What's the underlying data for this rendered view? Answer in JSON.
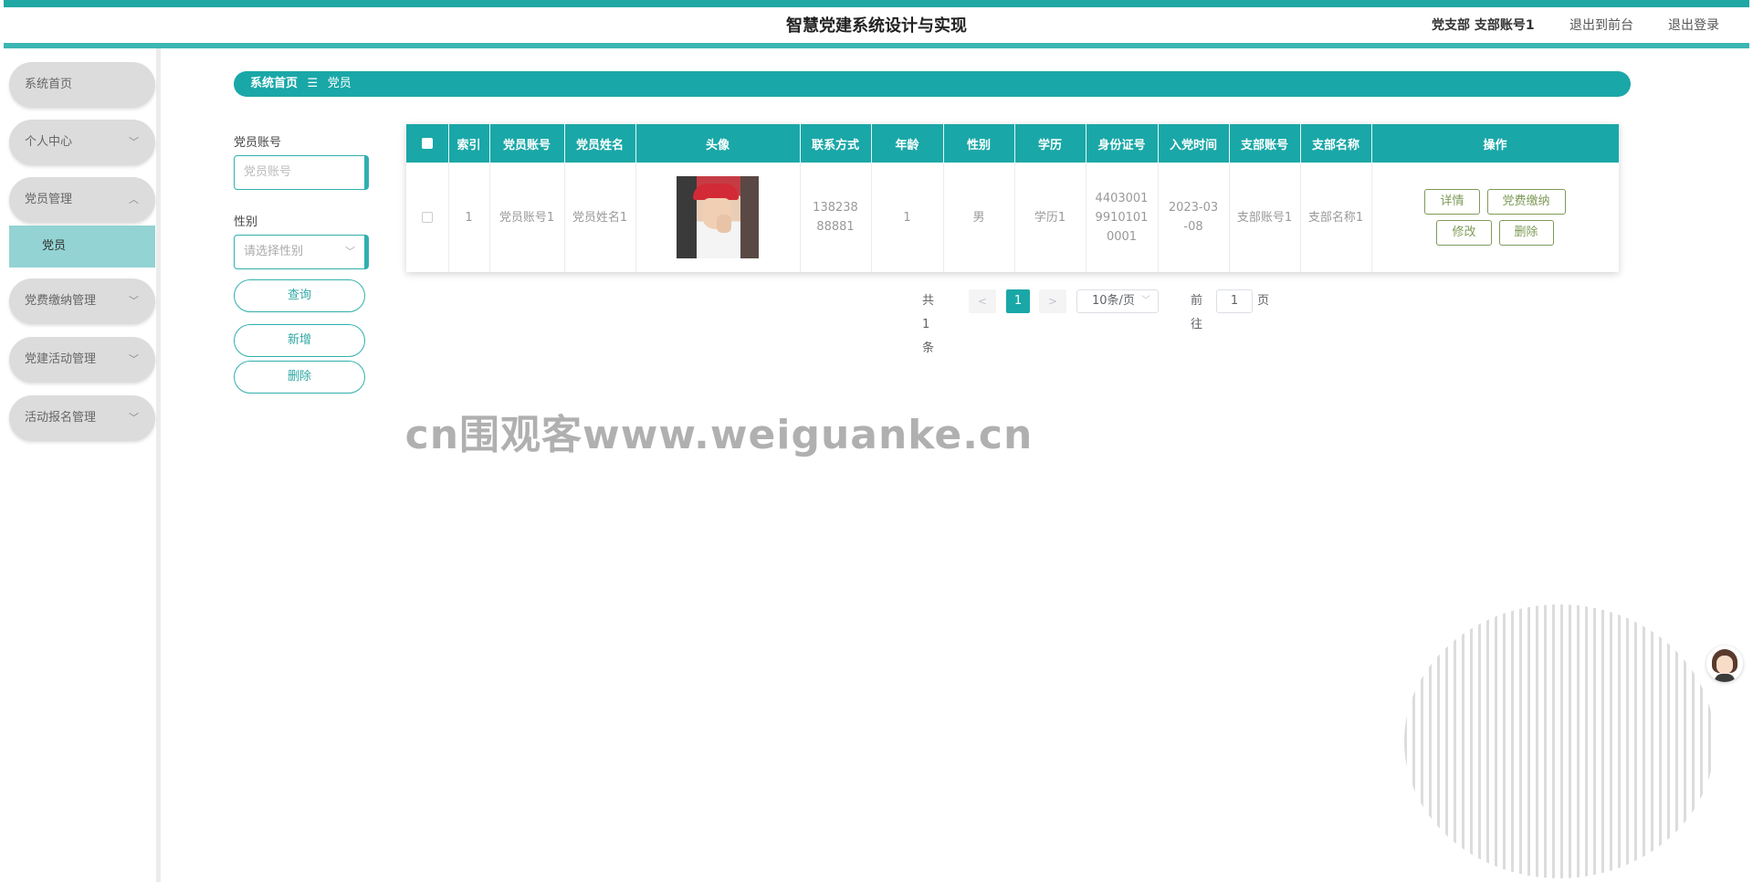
{
  "header": {
    "title": "智慧党建系统设计与实现",
    "user_label": "党支部 支部账号1",
    "to_front_label": "退出到前台",
    "logout_label": "退出登录"
  },
  "sidebar": {
    "items": [
      {
        "label": "系统首页"
      },
      {
        "label": "个人中心"
      },
      {
        "label": "党员管理"
      },
      {
        "label": "党员"
      },
      {
        "label": "党费缴纳管理"
      },
      {
        "label": "党建活动管理"
      },
      {
        "label": "活动报名管理"
      }
    ]
  },
  "breadcrumb": {
    "home": "系统首页",
    "separator": "☰",
    "current": "党员"
  },
  "search": {
    "account_label": "党员账号",
    "account_placeholder": "党员账号",
    "gender_label": "性别",
    "gender_placeholder": "请选择性别",
    "query_label": "查询",
    "add_label": "新增",
    "delete_label": "删除"
  },
  "table": {
    "columns": [
      "索引",
      "党员账号",
      "党员姓名",
      "头像",
      "联系方式",
      "年龄",
      "性别",
      "学历",
      "身份证号",
      "入党时间",
      "支部账号",
      "支部名称",
      "操作"
    ],
    "rows": [
      {
        "index": "1",
        "account": "党员账号1",
        "name": "党员姓名1",
        "phone": "13823888881",
        "age": "1",
        "gender": "男",
        "education": "学历1",
        "id_number": "440300199101010001",
        "join_date": "2023-03-08",
        "branch_account": "支部账号1",
        "branch_name": "支部名称1"
      }
    ],
    "actions": {
      "detail": "详情",
      "pay_fee": "党费缴纳",
      "edit": "修改",
      "delete": "删除"
    }
  },
  "pagination": {
    "total_text": "共 1 条",
    "prev": "<",
    "next": ">",
    "current_page": "1",
    "page_size": "10条/页",
    "goto_prefix": "前往",
    "goto_value": "1",
    "goto_suffix": "页"
  },
  "watermark": "cn围观客www.weiguanke.cn",
  "colors": {
    "primary": "#1aa7a7",
    "accent_light": "#93d3d3",
    "action_border": "#7e9b58",
    "menu_bg": "#dcdcdc"
  }
}
